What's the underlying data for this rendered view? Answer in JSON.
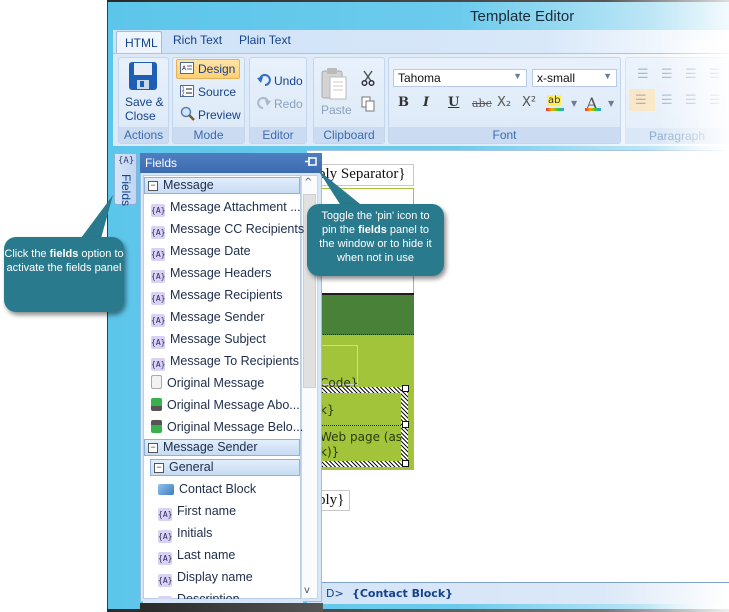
{
  "window": {
    "title": "Template Editor"
  },
  "tabs": [
    {
      "label": "HTML",
      "active": true
    },
    {
      "label": "Rich Text",
      "active": false
    },
    {
      "label": "Plain Text",
      "active": false
    }
  ],
  "ribbon": {
    "actions": {
      "group_label": "Actions",
      "save_close_line1": "Save &",
      "save_close_line2": "Close",
      "save_icon": "floppy-disk-icon"
    },
    "mode": {
      "group_label": "Mode",
      "design": "Design",
      "source": "Source",
      "preview": "Preview",
      "active": "Design"
    },
    "editor": {
      "group_label": "Editor",
      "undo": "Undo",
      "redo": "Redo"
    },
    "clipboard": {
      "group_label": "Clipboard",
      "paste": "Paste",
      "cut_icon": "scissors-icon",
      "copy_icon": "copy-icon"
    },
    "font": {
      "group_label": "Font",
      "font_name": "Tahoma",
      "font_size": "x-small",
      "bold": "B",
      "italic": "I",
      "underline": "U",
      "strikethrough": "abc",
      "subscript": "X₂",
      "superscript": "X²",
      "highlight": "ab",
      "font_color": "A"
    },
    "paragraph": {
      "group_label": "Paragraph"
    }
  },
  "fields_tab": {
    "label": "Fields",
    "icon": "{A}"
  },
  "fields_panel": {
    "title": "Fields",
    "pin_icon": "pin-icon",
    "groups": [
      {
        "label": "Message",
        "items": [
          {
            "label": "Message Attachment ...",
            "icon": "field"
          },
          {
            "label": "Message CC Recipients",
            "icon": "field"
          },
          {
            "label": "Message Date",
            "icon": "field"
          },
          {
            "label": "Message Headers",
            "icon": "field"
          },
          {
            "label": "Message Recipients",
            "icon": "field"
          },
          {
            "label": "Message Sender",
            "icon": "field"
          },
          {
            "label": "Message Subject",
            "icon": "field"
          },
          {
            "label": "Message To Recipients",
            "icon": "field"
          },
          {
            "label": "Original Message",
            "icon": "document"
          },
          {
            "label": "Original Message Abo...",
            "icon": "arrow-up"
          },
          {
            "label": "Original Message Belo...",
            "icon": "arrow-down"
          }
        ]
      },
      {
        "label": "Message Sender",
        "subgroups": [
          {
            "label": "General",
            "items": [
              {
                "label": "Contact Block",
                "icon": "contact-card"
              },
              {
                "label": "First name",
                "icon": "field"
              },
              {
                "label": "Initials",
                "icon": "field"
              },
              {
                "label": "Last name",
                "icon": "field"
              },
              {
                "label": "Display name",
                "icon": "field"
              },
              {
                "label": "Description",
                "icon": "field"
              }
            ]
          }
        ]
      }
    ]
  },
  "document": {
    "separator_text": "ply Separator}",
    "cell_code": "Code}",
    "cell_k": "k}",
    "cell_webpage_1": "Web page (as",
    "cell_webpage_2": "k)}",
    "reply_text": "ply}"
  },
  "statusbar": {
    "path_tail": "D>",
    "current": "{Contact Block}"
  },
  "callouts": {
    "fields_tip": {
      "pre": "Click the ",
      "bold": "fields",
      "post": " option to activate the fields panel"
    },
    "pin_tip": {
      "pre": "Toggle the 'pin' icon to pin the ",
      "bold": "fields",
      "post": " panel to the window or to hide it when not in use"
    }
  }
}
